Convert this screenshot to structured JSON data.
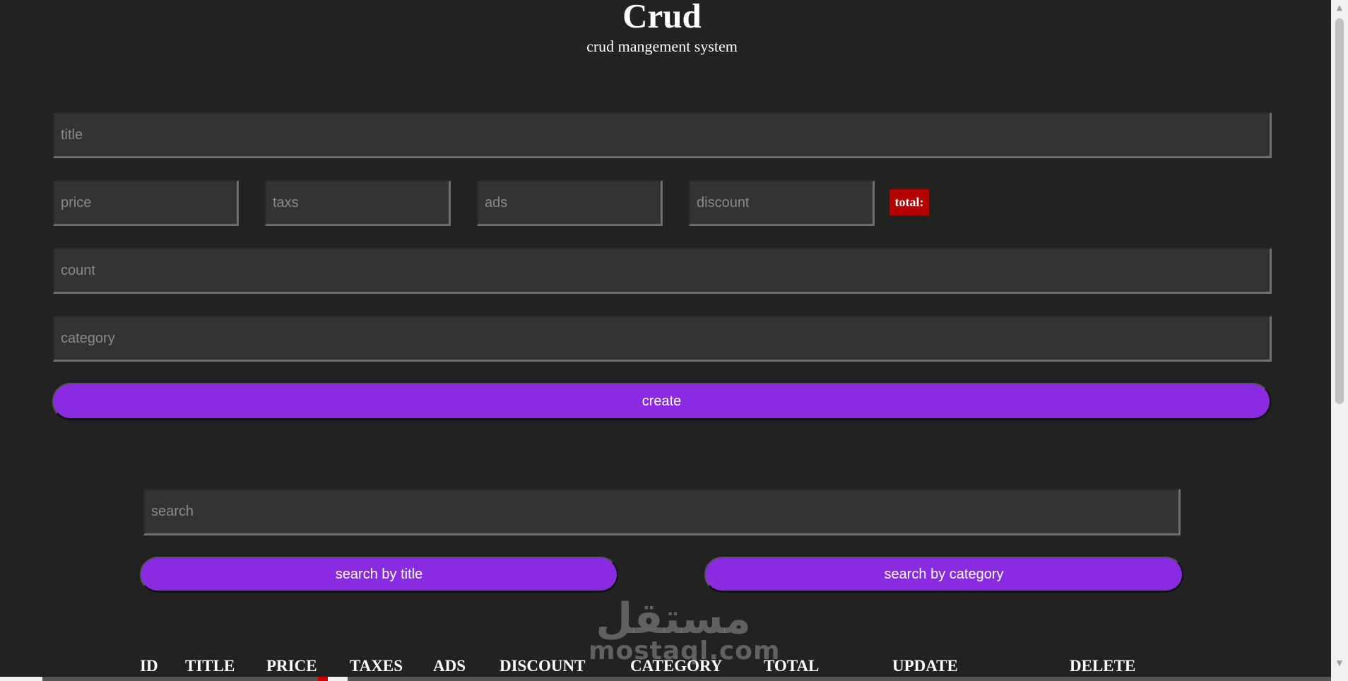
{
  "header": {
    "title": "Crud",
    "subtitle": "crud mangement system"
  },
  "form": {
    "title_placeholder": "title",
    "price_placeholder": "price",
    "taxs_placeholder": "taxs",
    "ads_placeholder": "ads",
    "discount_placeholder": "discount",
    "total_label": "total:",
    "count_placeholder": "count",
    "category_placeholder": "category",
    "create_label": "create"
  },
  "search": {
    "placeholder": "search",
    "by_title_label": "search by title",
    "by_category_label": "search by category"
  },
  "table": {
    "headers": [
      "ID",
      "TITLE",
      "PRICE",
      "TAXES",
      "ADS",
      "DISCOUNT",
      "CATEGORY",
      "TOTAL",
      "UPDATE",
      "DELETE"
    ]
  },
  "watermark": {
    "arabic": "مستقل",
    "latin": "mostaql.com"
  },
  "colors": {
    "background": "#222222",
    "input_bg": "#333333",
    "accent": "#8a2be2",
    "total_bg": "#b30000"
  }
}
